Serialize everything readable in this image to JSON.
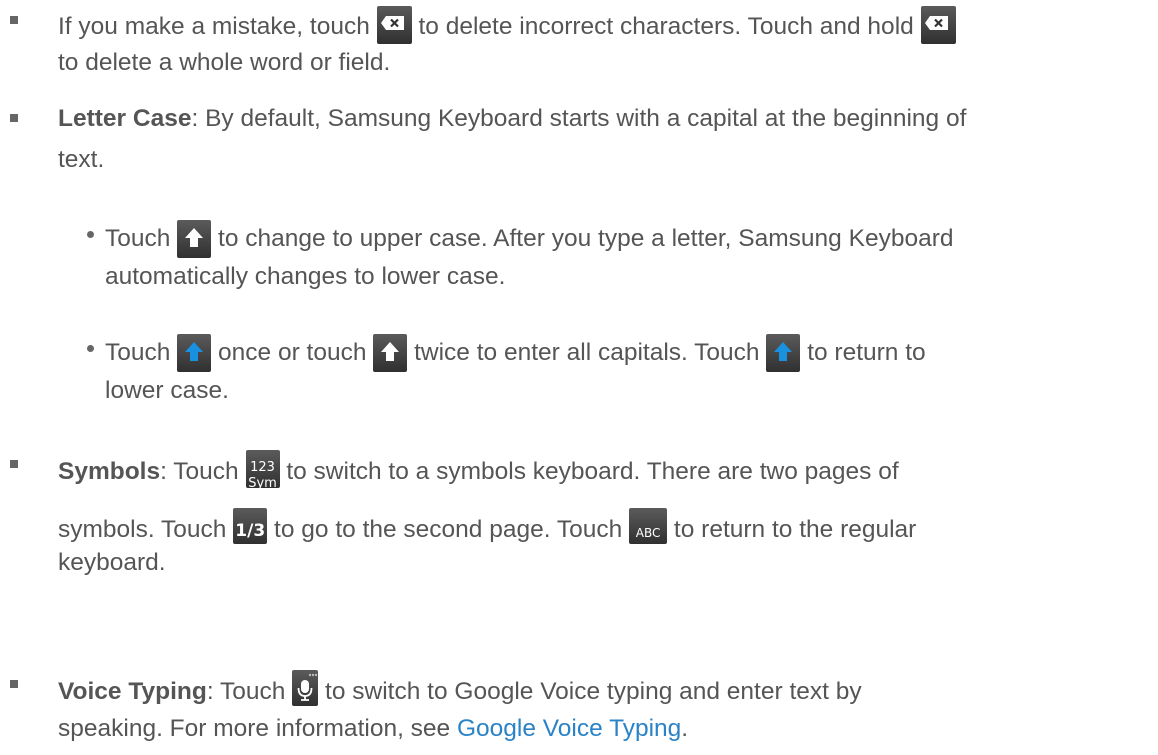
{
  "items": {
    "delete": {
      "t1": "If you make a mistake, touch",
      "t2": "to delete incorrect characters. Touch and hold",
      "t3": "to delete a whole word or field."
    },
    "letter_case": {
      "label": "Letter Case",
      "t1": ": By default, Samsung Keyboard starts with a capital at the beginning of",
      "t2": "text.",
      "sub1": {
        "t1": "Touch",
        "t2": "to change to upper case. After you type a letter, Samsung Keyboard",
        "t3": "automatically changes to lower case."
      },
      "sub2": {
        "t1": "Touch",
        "t2": "once or touch",
        "t3": "twice to enter all capitals. Touch",
        "t4": "to return to",
        "t5": "lower case."
      }
    },
    "symbols": {
      "label": "Symbols",
      "t1": ": Touch",
      "t2": "to switch to a symbols keyboard. There are two pages of",
      "t3": "symbols. Touch",
      "t4": "to go to the second page. Touch",
      "t5": "to return to the regular",
      "t6": "keyboard.",
      "key_sym_top": "123",
      "key_sym_bottom": "Sym",
      "key_page": "1/3",
      "key_abc": "ABC"
    },
    "voice": {
      "label": "Voice Typing",
      "t1": ": Touch",
      "t2": "to switch to Google Voice typing and enter text by",
      "t3": "speaking. For more information, see",
      "link": "Google Voice Typing",
      "t4": "."
    }
  },
  "icons": {
    "delete": "backspace-key-icon",
    "shift": "shift-key-icon",
    "shift_active": "shift-key-active-icon",
    "sym": "sym-key-icon",
    "page": "page-key-icon",
    "abc": "abc-key-icon",
    "mic": "microphone-key-icon"
  },
  "colors": {
    "text": "#555555",
    "link": "#2a83c6",
    "bullet": "#666666",
    "active_arrow": "#1a90e0"
  }
}
